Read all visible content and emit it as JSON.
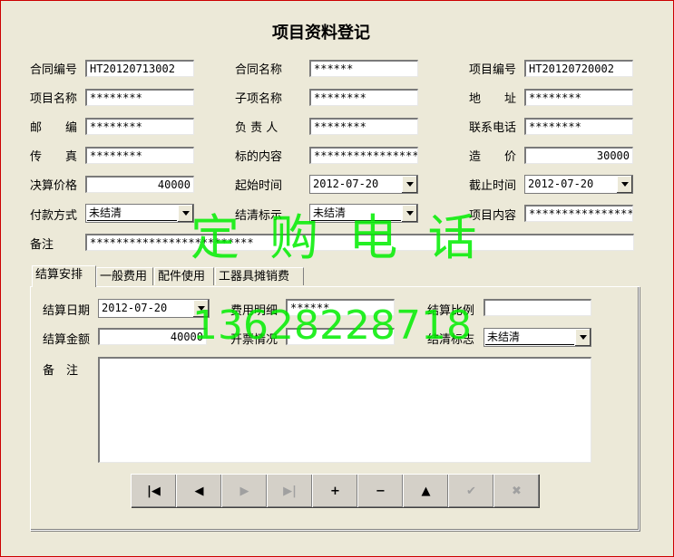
{
  "form": {
    "title": "项目资料登记",
    "contract_no_label": "合同编号",
    "contract_no": "HT20120713002",
    "contract_name_label": "合同名称",
    "contract_name": "******",
    "project_no_label": "项目编号",
    "project_no": "HT20120720002",
    "project_name_label": "项目名称",
    "project_name": "********",
    "subitem_name_label": "子项名称",
    "subitem_name": "********",
    "address_label": "地　　址",
    "address": "********",
    "postcode_label": "邮　　编",
    "postcode": "********",
    "owner_label": "负 责 人",
    "owner": "********",
    "phone_label": "联系电话",
    "phone": "********",
    "fax_label": "传　　真",
    "fax": "********",
    "bid_content_label": "标的内容",
    "bid_content": "****************",
    "cost_label": "造　　价",
    "cost": "30000",
    "final_price_label": "决算价格",
    "final_price": "40000",
    "start_time_label": "起始时间",
    "start_time": "2012-07-20",
    "end_time_label": "截止时间",
    "end_time": "2012-07-20",
    "payment_label": "付款方式",
    "payment": "未结清",
    "settle_flag_label": "结清标示",
    "settle_flag": "未结清",
    "content_label": "项目内容",
    "content": "****************",
    "remark_label": "备注",
    "remark": "*************************"
  },
  "tabs": [
    "结算安排",
    "一般费用",
    "配件使用",
    "工器具摊销费"
  ],
  "settlement": {
    "date_label": "结算日期",
    "date": "2012-07-20",
    "fee_detail_label": "费用明细",
    "fee_detail": "******",
    "ratio_label": "结算比例",
    "ratio": "",
    "amount_label": "结算金额",
    "amount": "40000",
    "invoice_label": "开票情况",
    "invoice": "",
    "flag_label": "结清标志",
    "flag": "未结清",
    "remark_label": "备　注"
  },
  "nav_buttons": {
    "first": "|◀",
    "prev": "◀",
    "next": "▶",
    "last": "▶|",
    "add": "+",
    "delete": "−",
    "up": "▲",
    "post": "✔",
    "cancel": "✖"
  },
  "watermark": {
    "line1": "定 购 电 话",
    "line2": "13628228718"
  },
  "colors": {
    "watermark": "#00ee00",
    "background": "#ece9d8",
    "border": "#cc0000"
  }
}
